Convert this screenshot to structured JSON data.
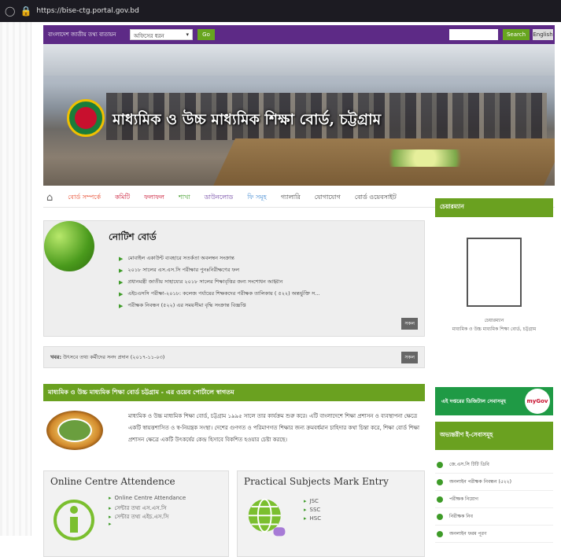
{
  "browser": {
    "url": "https://bise-ctg.portal.gov.bd"
  },
  "topbar": {
    "portal_label": "বাংলাদেশ জাতীয় তথ্য বাতায়ন",
    "office_select": "অফিসের ধরন",
    "go_label": "Go",
    "search_label": "Search",
    "english_label": "English"
  },
  "banner": {
    "title": "মাধ্যমিক ও উচ্চ মাধ্যমিক শিক্ষা বোর্ড, চট্টগ্রাম"
  },
  "nav": {
    "items": [
      {
        "label": "বোর্ড সম্পর্কে",
        "color": "#e8492c"
      },
      {
        "label": "কমিটি",
        "color": "#c8102e"
      },
      {
        "label": "ফলাফল",
        "color": "#c8102e"
      },
      {
        "label": "শাখা",
        "color": "#3e9b28"
      },
      {
        "label": "ডাউনলোড",
        "color": "#6b3fa0"
      },
      {
        "label": "ফি সমূহ",
        "color": "#4a8fd4"
      },
      {
        "label": "গ্যালারি",
        "color": "#444444"
      },
      {
        "label": "যোগাযোগ",
        "color": "#444444"
      },
      {
        "label": "বোর্ড ওয়েবসাইট",
        "color": "#444444"
      }
    ]
  },
  "notice": {
    "title": "নোটিশ বোর্ড",
    "items": [
      "মোবাইল একাউন্ট ব্যবহারে সতর্কতা অবলম্বন সংক্রান্ত",
      "২০১৮ সালের এস.এস.সি পরীক্ষার পুনঃনিরীক্ষণের ফল",
      "প্রধানমন্ত্রী জাতীয় সাহায্যের ২০১৮ সালের শিক্ষাবৃত্তির জন্য সংশোধন আহ্বান",
      "এইচএসসি পরীক্ষা-২০১৮: কলেজ পর্যায়ের শিক্ষকদের পরীক্ষক তালিকায় ( ৫২২) অন্তর্ভুক্তি স...",
      "পরীক্ষক নিবন্ধন (৫২২) এর সময়সীমা বৃদ্ধি সংক্রান্ত বিজ্ঞপ্তি"
    ],
    "all_label": "সকল"
  },
  "ticker": {
    "label": "খবর:",
    "text": "উৎসবে তথ্য কর্মীদের সনদ প্রদান (২০১৭-১১-০৩)",
    "all_label": "সকল"
  },
  "welcome": {
    "heading": "মাধ্যমিক ও উচ্চ মাধ্যমিক শিক্ষা বোর্ড চট্টগ্রাম - এর ওয়েব পোর্টালে স্বাগতম"
  },
  "about": {
    "text": "মাধ্যমিক ও উচ্চ মাধ্যমিক শিক্ষা বোর্ড, চট্টগ্রাম ১৯৯৫ সালে তার কার্যক্রম শুরু করে। এটি বাংলাদেশে শিক্ষা প্রশাসন ও ব্যবস্থাপনা ক্ষেত্রে একটি স্বায়ত্তশাসিত ও স্ব-নিয়ন্ত্রক সংস্থা। দেশের গুণগত ও পরিমাণগত শিক্ষার জন্য ক্রমবর্ধমান চাহিদার কথা চিন্তা করে, শিক্ষা বোর্ড শিক্ষা প্রশাসন ক্ষেত্রে একটি উৎকর্ষের কেন্দ্র হিসাবে বিকশিত হওয়ার চেষ্টা করছে।"
  },
  "cards": [
    {
      "title": "Online Centre Attendence",
      "icon": "info-icon",
      "items": [
        "Online Centre Attendance",
        "সেন্টার তথ্য এস.এস.সি",
        "সেন্টার তথ্য এইচ.এস.সি",
        ""
      ]
    },
    {
      "title": "Practical Subjects Mark Entry",
      "icon": "globe-mouse-icon",
      "items": [
        "JSC",
        "SSC",
        "HSC"
      ]
    }
  ],
  "sidebar": {
    "chairman_header": "চেয়ারম্যান",
    "chairman_caption": "চেয়ারম্যান",
    "chairman_org": "মাধ্যমিক ও উচ্চ মাধ্যমিক শিক্ষা বোর্ড, চট্টগ্রাম",
    "digital_label": "এই দপ্তরের ডিজিটাল সেবাসমূহ",
    "mygov_label": "myGov",
    "eservices_header": "অভ্যন্তরীণ ই-সেবাসমূহ",
    "eservices": [
      "জে.এস.সি টিটি ডিবি",
      "অনলাইন পরীক্ষক নিবন্ধন (৫২২)",
      "পরীক্ষক নিয়োগ",
      "নিরীক্ষক নিব",
      "অনলাইন ফরম পূরণ"
    ]
  }
}
